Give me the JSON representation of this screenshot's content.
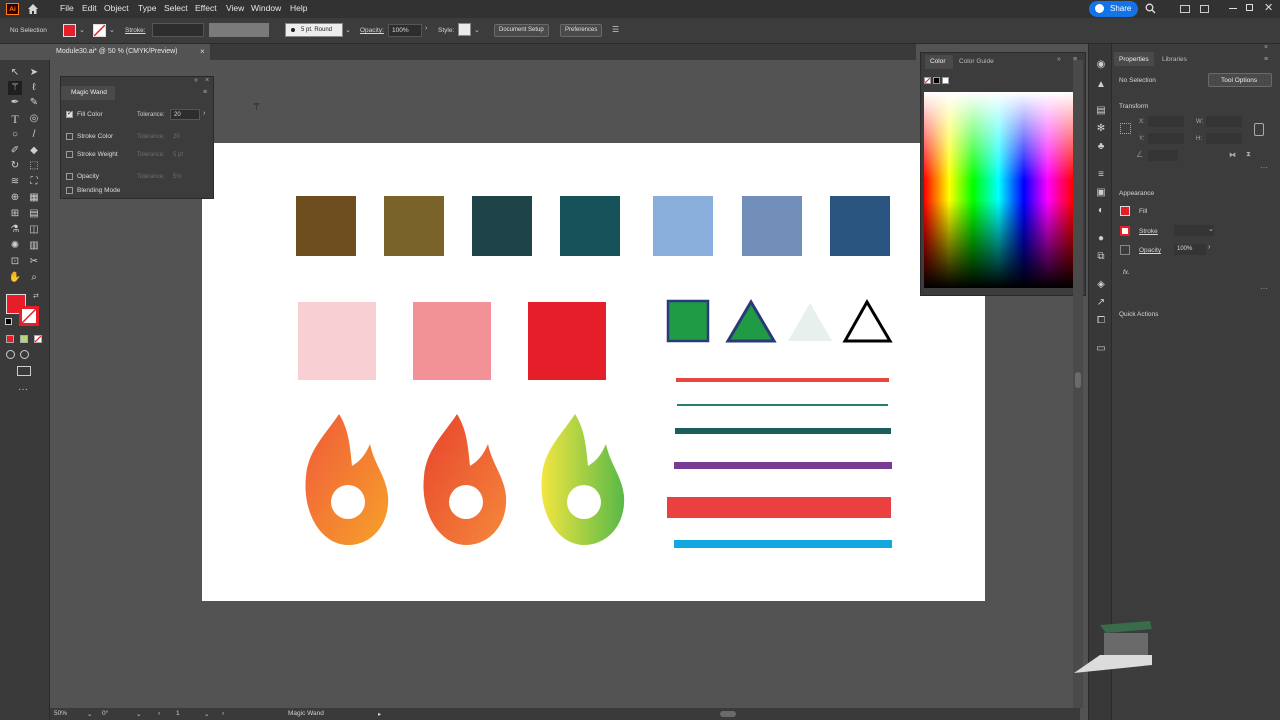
{
  "app": {
    "logo": "Ai"
  },
  "menu": [
    "File",
    "Edit",
    "Object",
    "Type",
    "Select",
    "Effect",
    "View",
    "Window",
    "Help"
  ],
  "share_label": "Share",
  "control_bar": {
    "selection": "No Selection",
    "stroke_label": "Stroke:",
    "stroke_profile": "5 pt. Round",
    "opacity_label": "Opacity:",
    "opacity_value": "100%",
    "style_label": "Style:",
    "document_setup": "Document Setup",
    "preferences": "Preferences"
  },
  "document_tab": "Module30.ai* @ 50 % (CMYK/Preview)",
  "magic_wand": {
    "title": "Magic Wand",
    "fill_color": "Fill Color",
    "tolerance_label": "Tolerance:",
    "tolerance_value": "20",
    "stroke_color": "Stroke Color",
    "stroke_weight": "Stroke Weight",
    "opacity": "Opacity",
    "blending_mode": "Blending Mode",
    "dim_tolerance": "Tolerance:",
    "dim_value_1": "20",
    "dim_value_2": "5 pt",
    "dim_value_3": "5%"
  },
  "color_panel": {
    "tab_color": "Color",
    "tab_guide": "Color Guide"
  },
  "properties": {
    "tab_properties": "Properties",
    "tab_libraries": "Libraries",
    "selection": "No Selection",
    "tool_options": "Tool Options",
    "transform": "Transform",
    "x_label": "X:",
    "y_label": "Y:",
    "w_label": "W:",
    "h_label": "H:",
    "appearance": "Appearance",
    "fill": "Fill",
    "stroke": "Stroke",
    "opacity": "Opacity",
    "opacity_value": "100%",
    "fx": "fx.",
    "quick_actions": "Quick Actions"
  },
  "status": {
    "zoom": "50%",
    "rotation": "0°",
    "artboard": "1",
    "tool": "Magic Wand"
  },
  "colors": {
    "row1": [
      "#6e4e1f",
      "#7a6328",
      "#1e4348",
      "#17525a",
      "#8aaedb",
      "#718fb8",
      "#2a5580"
    ],
    "row2": [
      "#f8d0d3",
      "#f29297",
      "#e61e29"
    ],
    "lines": [
      "#e8473f",
      "#237d70",
      "#1b5f5d",
      "#7a3b94",
      "#ea4040",
      "#12a7e0"
    ],
    "fill_swatch": "#e61e29",
    "green_shape": "#1f9a45",
    "navy_stroke": "#2a3a78"
  }
}
